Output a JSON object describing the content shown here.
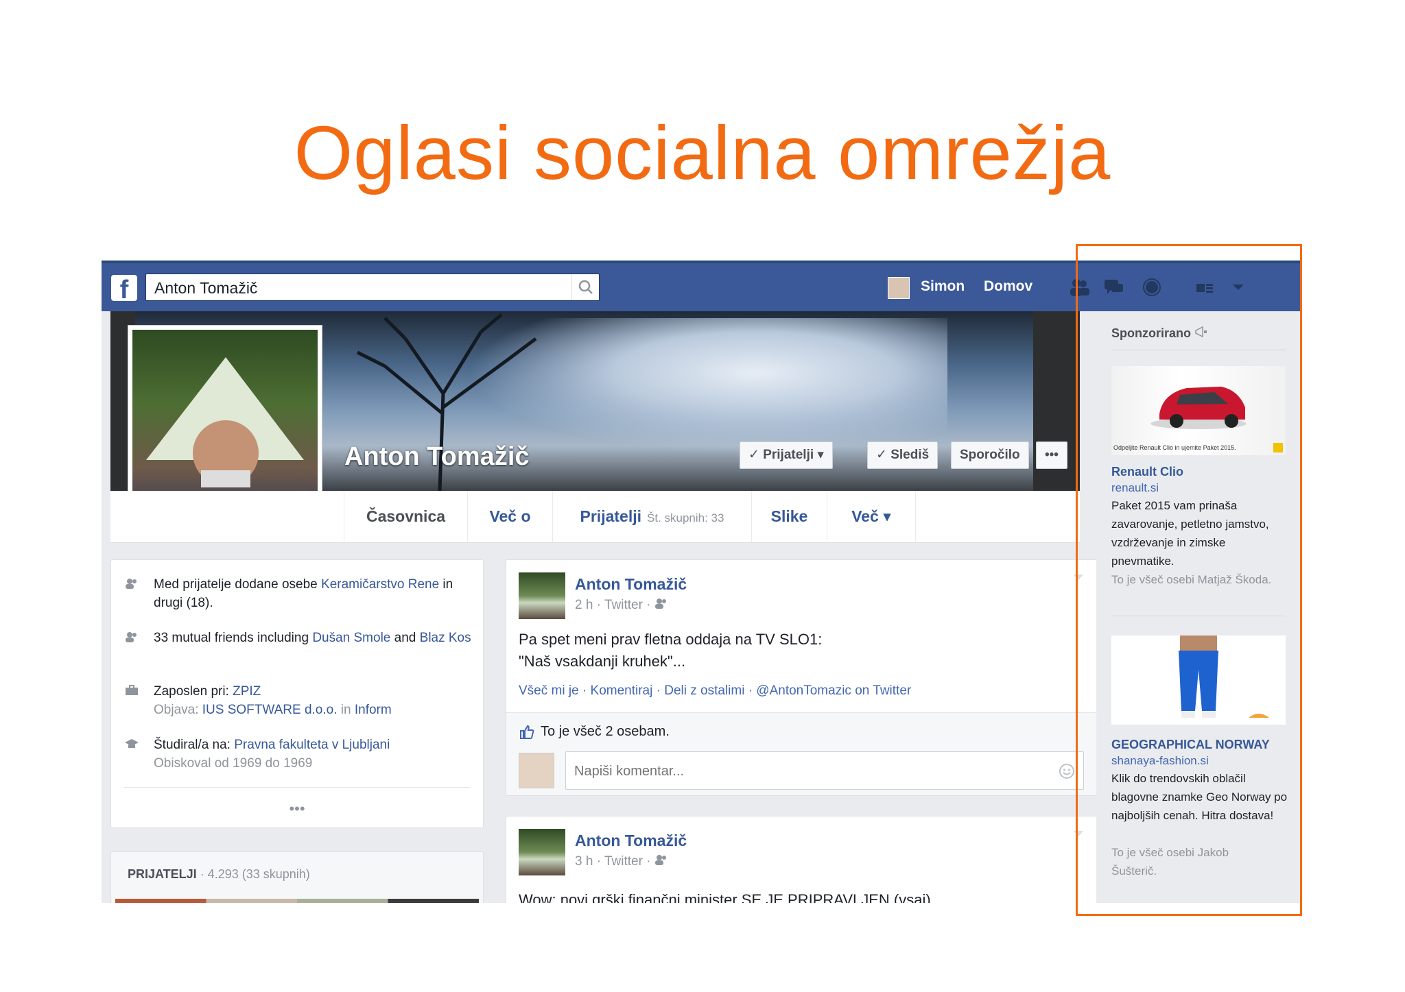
{
  "slide": {
    "title": "Oglasi socialna omrežja"
  },
  "header": {
    "logo": "f",
    "search_value": "Anton Tomažič",
    "user_name": "Simon",
    "home_label": "Domov"
  },
  "profile": {
    "name": "Anton Tomažič",
    "buttons": {
      "friends": "✓ Prijatelji ▾",
      "following": "✓ Slediš",
      "message": "Sporočilo",
      "more": "•••"
    },
    "tabs": {
      "timeline": "Časovnica",
      "about": "Več o",
      "friends": "Prijatelji",
      "friends_sub": "Št. skupnih: 33",
      "photos": "Slike",
      "more": "Več ▾"
    }
  },
  "intro": {
    "item1_a": "Med prijatelje dodane osebe ",
    "item1_link": "Keramičarstvo Rene",
    "item1_b": " in drugi (18).",
    "item2_a": "33 mutual friends including ",
    "item2_link": "Dušan Smole",
    "item2_b": " and ",
    "item2_link2": "Blaz Kos",
    "item3_a": "Zaposlen pri: ",
    "item3_link": "ZPIZ",
    "item3_sub_a": "Objava: ",
    "item3_sub_link": "IUS SOFTWARE d.o.o.",
    "item3_sub_b": " in ",
    "item3_sub_link2": "Inform",
    "item4_a": "Študiral/a na: ",
    "item4_link": "Pravna fakulteta v Ljubljani",
    "item4_sub": "Obiskoval od 1969 do 1969",
    "more": "•••"
  },
  "friends_box": {
    "label": "PRIJATELJI",
    "count": " · 4.293 (33 skupnih)"
  },
  "posts": [
    {
      "author": "Anton Tomažič",
      "meta": "2 h · Twitter · ",
      "text_line1": "Pa spet meni prav fletna oddaja na TV SLO1:",
      "text_line2": "\"Naš vsakdanji kruhek\"...",
      "actions": "Všeč mi je · Komentiraj · Deli z ostalimi · @AntonTomazic on Twitter",
      "likes": "To je všeč 2 osebam.",
      "comment_placeholder": "Napiši komentar..."
    },
    {
      "author": "Anton Tomažič",
      "meta": "3 h · Twitter · ",
      "text_line1": "Wow: novi grški finančni minister SE JE PRIPRAVLJEN (vsaj)"
    }
  ],
  "sponsored": {
    "header": "Sponzorirano",
    "ads": [
      {
        "image_caption": "Odpeljite Renault Clio in ujemite Paket 2015.",
        "title": "Renault Clio",
        "domain": "renault.si",
        "body": "Paket 2015 vam prinaša zavarovanje, petletno jamstvo, vzdrževanje in zimske pnevmatike.",
        "social": "To je všeč osebi Matjaž Škoda."
      },
      {
        "title": "GEOGRAPHICAL NORWAY",
        "domain": "shanaya-fashion.si",
        "body": "Klik do trendovskih oblačil blagovne znamke Geo Norway po najboljših cenah. Hitra dostava!",
        "social": "To je všeč osebi Jakob Šušterič."
      }
    ]
  },
  "colors": {
    "accent_title": "#f26b12",
    "fb_blue": "#3b5998",
    "link": "#365899"
  }
}
